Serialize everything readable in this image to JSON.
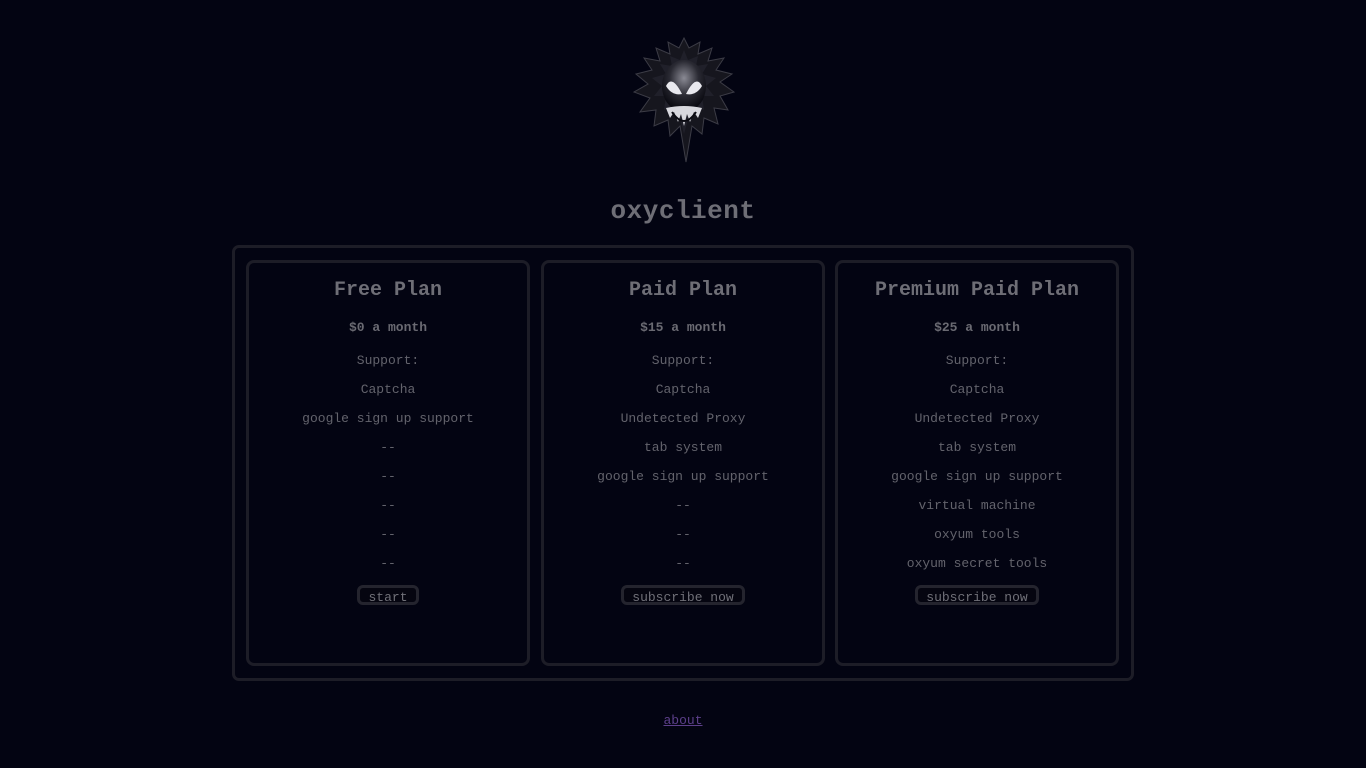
{
  "brand": {
    "title": "oxyclient"
  },
  "plans": [
    {
      "name": "Free Plan",
      "price": "$0 a month",
      "features": [
        "Support:",
        "Captcha",
        "google sign up support",
        "--",
        "--",
        "--",
        "--",
        "--"
      ],
      "button": "start"
    },
    {
      "name": "Paid Plan",
      "price": "$15 a month",
      "features": [
        "Support:",
        "Captcha",
        "Undetected Proxy",
        "tab system",
        "google sign up support",
        "--",
        "--",
        "--"
      ],
      "button": "subscribe now"
    },
    {
      "name": "Premium Paid Plan",
      "price": "$25 a month",
      "features": [
        "Support:",
        "Captcha",
        "Undetected Proxy",
        "tab system",
        "google sign up support",
        "virtual machine",
        "oxyum tools",
        "oxyum secret tools"
      ],
      "button": "subscribe now"
    }
  ],
  "footer": {
    "about_link": "about"
  },
  "colors": {
    "background": "#030412",
    "border": "#1d1d27",
    "text": "#6f6f78",
    "link": "#5c3f8a"
  },
  "icons": {
    "logo": "venom-mask-logo"
  }
}
